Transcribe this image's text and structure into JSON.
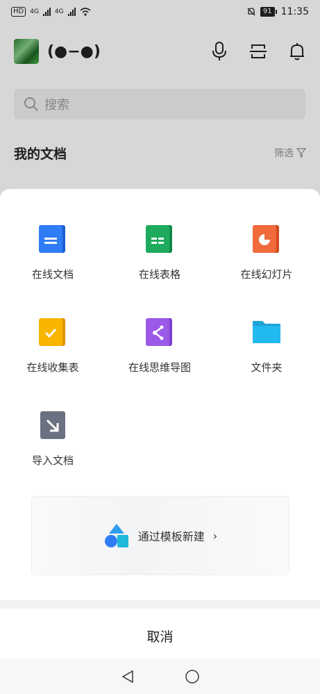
{
  "status_bar": {
    "left_tag": "HD",
    "net": "4G",
    "time": "11:35",
    "battery": "91"
  },
  "header": {
    "username": "(●−●)",
    "icons": [
      "mic-icon",
      "scan-icon",
      "bell-icon"
    ]
  },
  "search": {
    "placeholder": "搜索"
  },
  "documents": {
    "title": "我的文档",
    "filter_label": "筛选"
  },
  "create_sheet": {
    "items": [
      {
        "label": "在线文档",
        "icon": "doc-icon",
        "color": "#2f7df6"
      },
      {
        "label": "在线表格",
        "icon": "sheet-icon",
        "color": "#1fab5e"
      },
      {
        "label": "在线幻灯片",
        "icon": "slides-icon",
        "color": "#f06a3c"
      },
      {
        "label": "在线收集表",
        "icon": "form-icon",
        "color": "#f7b500"
      },
      {
        "label": "在线思维导图",
        "icon": "mindmap-icon",
        "color": "#9b59e8"
      },
      {
        "label": "文件夹",
        "icon": "folder-icon",
        "color": "#22b8f0"
      },
      {
        "label": "导入文档",
        "icon": "import-icon",
        "color": "#6b7180"
      }
    ],
    "template_button": "通过模板新建",
    "template_chevron": "›"
  },
  "cancel_label": "取消",
  "nav": {
    "icons": [
      "back-icon",
      "home-icon"
    ]
  }
}
